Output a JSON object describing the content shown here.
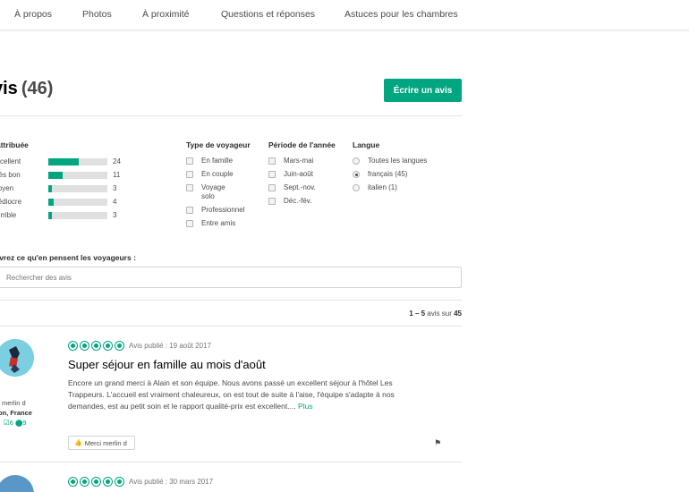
{
  "nav": {
    "tabs": [
      "À propos",
      "Photos",
      "À proximité",
      "Questions et réponses",
      "Astuces pour les chambres"
    ]
  },
  "reviews_section": {
    "title": "vis",
    "count": "(46)",
    "write_button": "Écrire un avis"
  },
  "filters": {
    "rating": {
      "title": "attribuée",
      "rows": [
        {
          "label": "xcellent",
          "count": "24",
          "fraction": 0.52
        },
        {
          "label": "rès bon",
          "count": "11",
          "fraction": 0.24
        },
        {
          "label": "loyen",
          "count": "3",
          "fraction": 0.065
        },
        {
          "label": "lédiocre",
          "count": "4",
          "fraction": 0.087
        },
        {
          "label": "orrible",
          "count": "3",
          "fraction": 0.065
        }
      ]
    },
    "traveler_type": {
      "title": "Type de voyageur",
      "options": [
        "En famille",
        "En couple",
        "Voyage solo",
        "Professionnel",
        "Entre amis"
      ]
    },
    "period": {
      "title": "Période de l'année",
      "options": [
        "Mars-mai",
        "Juin-août",
        "Sept.-nov.",
        "Déc.-fév."
      ]
    },
    "language": {
      "title": "Langue",
      "options": [
        {
          "label": "Toutes les langues",
          "selected": false
        },
        {
          "label": "français (45)",
          "selected": true
        },
        {
          "label": "italien (1)",
          "selected": false
        }
      ]
    }
  },
  "search": {
    "label": "uvrez ce qu'en pensent les voyageurs :",
    "placeholder": "Rechercher des avis"
  },
  "pagination": {
    "range": "1 – 5",
    "middle": " avis sur ",
    "total": "45"
  },
  "reviews": [
    {
      "user_name": "merlin d",
      "user_location": "on, France",
      "user_stats": "☑6 ⬤9",
      "bubbles": 5,
      "published": "Avis publié : 19 août 2017",
      "title": "Super séjour en famille au mois d'août",
      "body": "Encore un grand merci à Alain et son équipe. Nous avons passé un excellent séjour à l'hôtel Les Trappeurs. L'accueil est vraiment chaleureux, on est tout de suite à l'aise, l'équipe s'adapte à nos demandes, est au petit soin et le rapport qualité-prix est excellent....",
      "more": "Plus",
      "thanks": "Merci merlin d"
    },
    {
      "bubbles": 5,
      "published": "Avis publié : 30 mars 2017"
    }
  ],
  "colors": {
    "accent": "#00a680",
    "bar_bg": "#e0e0e0",
    "text": "#2c2c2c"
  }
}
